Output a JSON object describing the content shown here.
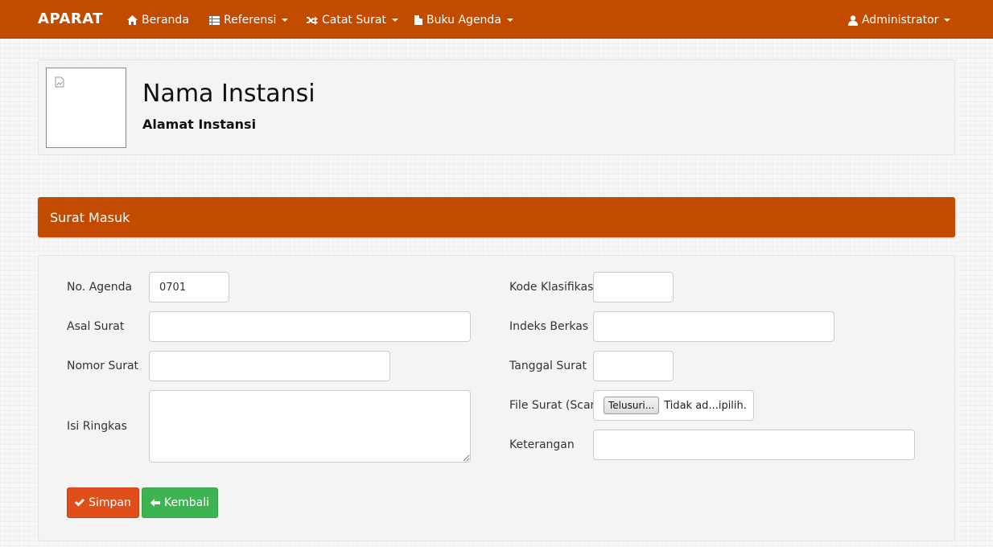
{
  "navbar": {
    "brand": "APARAT",
    "items": [
      {
        "label": "Beranda",
        "icon": "home-icon"
      },
      {
        "label": "Referensi",
        "icon": "list-icon"
      },
      {
        "label": "Catat Surat",
        "icon": "shuffle-icon"
      },
      {
        "label": "Buku Agenda",
        "icon": "file-icon"
      }
    ],
    "user": {
      "label": "Administrator",
      "icon": "user-icon"
    }
  },
  "header": {
    "name": "Nama Instansi",
    "address": "Alamat Instansi"
  },
  "section": {
    "title": "Surat Masuk"
  },
  "form": {
    "no_agenda": {
      "label": "No. Agenda",
      "value": "0701"
    },
    "asal_surat": {
      "label": "Asal Surat",
      "value": ""
    },
    "nomor_surat": {
      "label": "Nomor Surat",
      "value": ""
    },
    "isi_ringkas": {
      "label": "Isi Ringkas",
      "value": ""
    },
    "kode_klasifikasi": {
      "label": "Kode Klasifikasi",
      "value": ""
    },
    "indeks_berkas": {
      "label": "Indeks Berkas",
      "value": ""
    },
    "tanggal_surat": {
      "label": "Tanggal Surat",
      "value": ""
    },
    "file_surat": {
      "label": "File Surat (Scan)",
      "button": "Telusuri...",
      "status": "Tidak ad...ipilih."
    },
    "keterangan": {
      "label": "Keterangan",
      "value": ""
    }
  },
  "buttons": {
    "save": "Simpan",
    "back": "Kembali"
  },
  "colors": {
    "primary": "#c24b00",
    "save": "#e04f1a",
    "back": "#3cb452"
  }
}
